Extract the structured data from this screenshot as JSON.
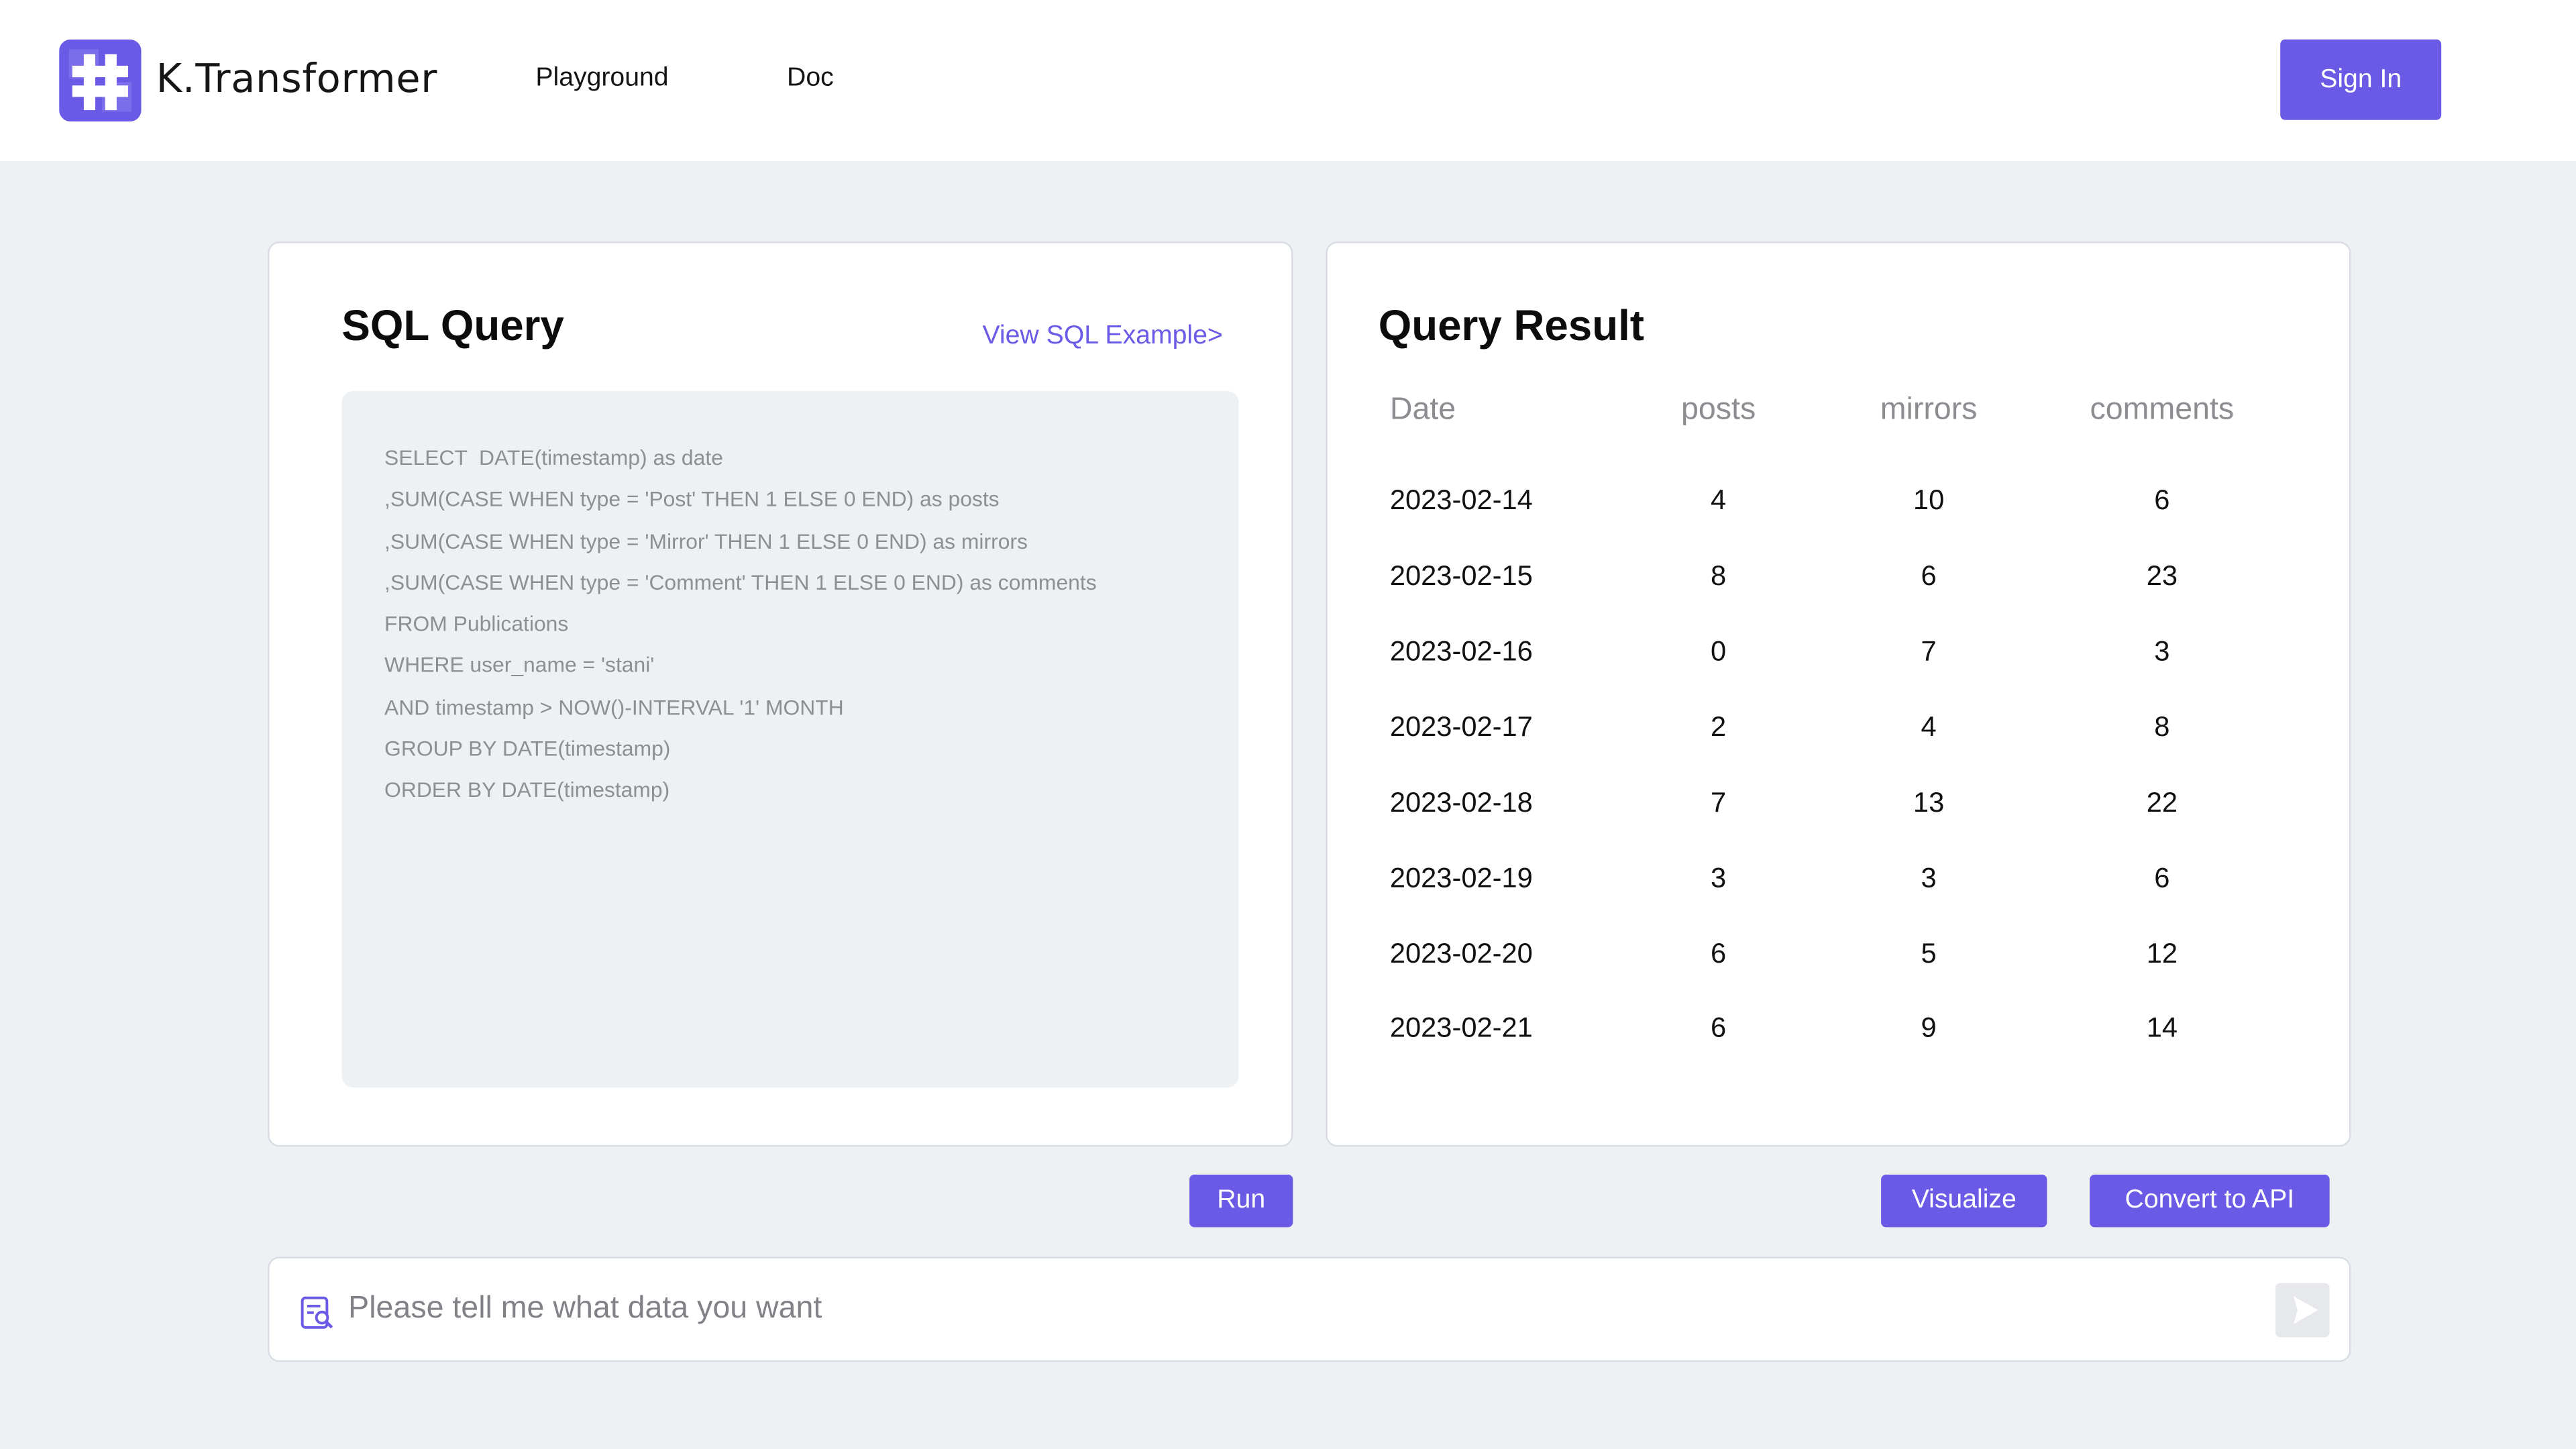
{
  "header": {
    "brand": "K.Transformer",
    "nav": [
      {
        "label": "Playground"
      },
      {
        "label": "Doc"
      }
    ],
    "sign_in": "Sign In"
  },
  "sql_panel": {
    "title": "SQL Query",
    "example_link": "View SQL Example>",
    "lines": [
      "SELECT  DATE(timestamp) as date",
      ",SUM(CASE WHEN type = 'Post' THEN 1 ELSE 0 END) as posts",
      ",SUM(CASE WHEN type = 'Mirror' THEN 1 ELSE 0 END) as mirrors",
      ",SUM(CASE WHEN type = 'Comment' THEN 1 ELSE 0 END) as comments",
      "FROM Publications",
      "WHERE user_name = 'stani'",
      "AND timestamp > NOW()-INTERVAL '1' MONTH",
      "GROUP BY DATE(timestamp)",
      "ORDER BY DATE(timestamp)"
    ]
  },
  "result_panel": {
    "title": "Query Result",
    "columns": [
      "Date",
      "posts",
      "mirrors",
      "comments"
    ],
    "rows": [
      [
        "2023-02-14",
        "4",
        "10",
        "6"
      ],
      [
        "2023-02-15",
        "8",
        "6",
        "23"
      ],
      [
        "2023-02-16",
        "0",
        "7",
        "3"
      ],
      [
        "2023-02-17",
        "2",
        "4",
        "8"
      ],
      [
        "2023-02-18",
        "7",
        "13",
        "22"
      ],
      [
        "2023-02-19",
        "3",
        "3",
        "6"
      ],
      [
        "2023-02-20",
        "6",
        "5",
        "12"
      ],
      [
        "2023-02-21",
        "6",
        "9",
        "14"
      ]
    ]
  },
  "actions": {
    "run": "Run",
    "visualize": "Visualize",
    "convert_to_api": "Convert to API"
  },
  "prompt": {
    "placeholder": "Please tell me what data you want",
    "value": "",
    "icon": "search-document-icon",
    "send_icon": "send-icon"
  },
  "colors": {
    "accent": "#6a5ae6",
    "background": "#eef1f4",
    "panel": "#ffffff"
  }
}
